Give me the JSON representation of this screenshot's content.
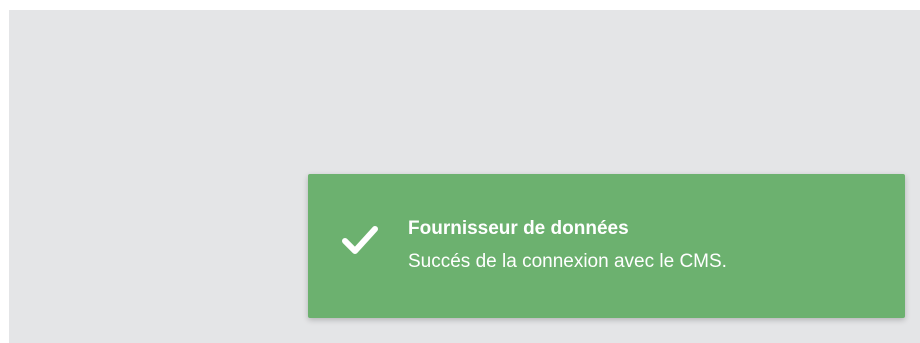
{
  "toast": {
    "type": "success",
    "icon": "checkmark-icon",
    "title": "Fournisseur de données",
    "message": "Succés de la connexion avec le CMS.",
    "background_color": "#6cb16f",
    "text_color": "#ffffff"
  },
  "app": {
    "background_color": "#e4e5e7"
  }
}
